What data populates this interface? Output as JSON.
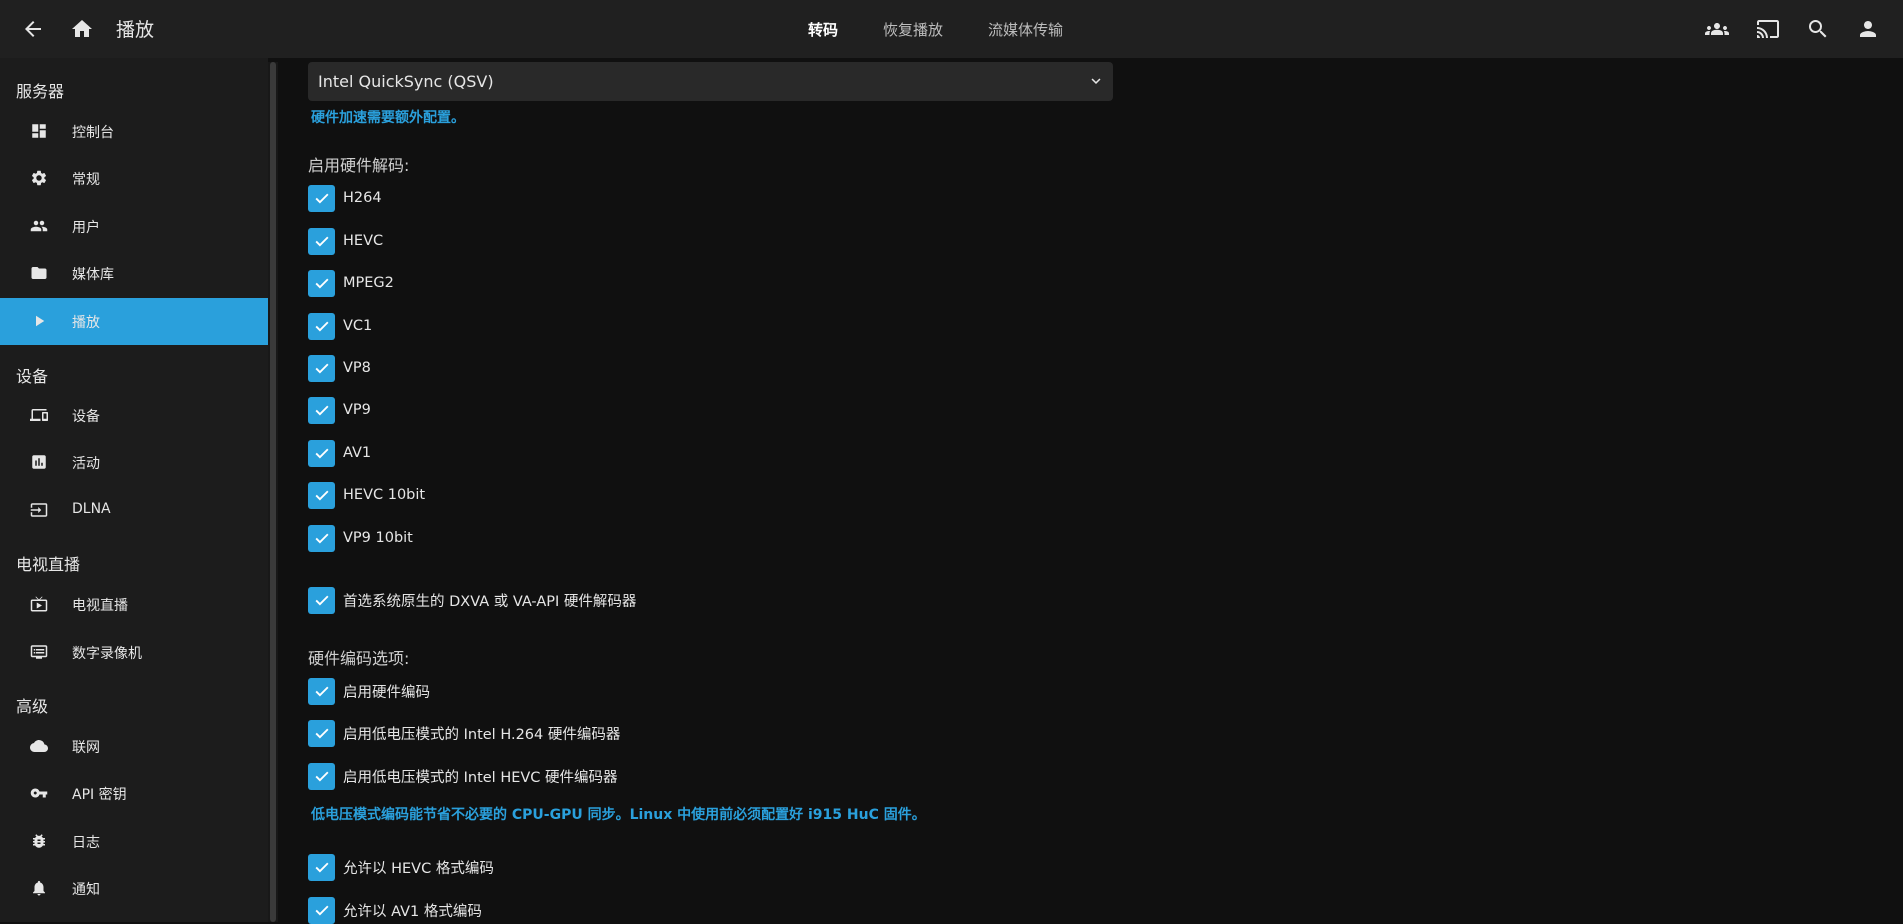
{
  "header": {
    "title": "播放",
    "tabs": [
      {
        "label": "转码",
        "active": true
      },
      {
        "label": "恢复播放",
        "active": false
      },
      {
        "label": "流媒体传输",
        "active": false
      }
    ],
    "icons": [
      "back-arrow-icon",
      "home-icon",
      "users-group-icon",
      "cast-icon",
      "search-icon",
      "user-icon"
    ]
  },
  "sidebar": {
    "sections": [
      {
        "heading": "服务器",
        "items": [
          {
            "label": "控制台",
            "icon": "dashboard-icon"
          },
          {
            "label": "常规",
            "icon": "gear-icon"
          },
          {
            "label": "用户",
            "icon": "people-icon"
          },
          {
            "label": "媒体库",
            "icon": "folder-icon"
          },
          {
            "label": "播放",
            "icon": "play-icon",
            "active": true
          }
        ]
      },
      {
        "heading": "设备",
        "items": [
          {
            "label": "设备",
            "icon": "devices-icon"
          },
          {
            "label": "活动",
            "icon": "activity-chart-icon"
          },
          {
            "label": "DLNA",
            "icon": "input-icon"
          }
        ]
      },
      {
        "heading": "电视直播",
        "items": [
          {
            "label": "电视直播",
            "icon": "live-tv-icon"
          },
          {
            "label": "数字录像机",
            "icon": "dvr-icon"
          }
        ]
      },
      {
        "heading": "高级",
        "items": [
          {
            "label": "联网",
            "icon": "cloud-icon"
          },
          {
            "label": "API 密钥",
            "icon": "key-icon"
          },
          {
            "label": "日志",
            "icon": "bug-icon"
          },
          {
            "label": "通知",
            "icon": "bell-icon"
          }
        ]
      }
    ]
  },
  "main": {
    "hw_accel": {
      "value": "Intel QuickSync (QSV)",
      "note": "硬件加速需要额外配置。"
    },
    "decode": {
      "label": "启用硬件解码:",
      "options": [
        {
          "label": "H264",
          "checked": true
        },
        {
          "label": "HEVC",
          "checked": true
        },
        {
          "label": "MPEG2",
          "checked": true
        },
        {
          "label": "VC1",
          "checked": true
        },
        {
          "label": "VP8",
          "checked": true
        },
        {
          "label": "VP9",
          "checked": true
        },
        {
          "label": "AV1",
          "checked": true
        },
        {
          "label": "HEVC 10bit",
          "checked": true
        },
        {
          "label": "VP9 10bit",
          "checked": true
        }
      ]
    },
    "prefer_native": {
      "label": "首选系统原生的 DXVA 或 VA-API 硬件解码器",
      "checked": true
    },
    "encode": {
      "label": "硬件编码选项:",
      "options": [
        {
          "label": "启用硬件编码",
          "checked": true
        },
        {
          "label": "启用低电压模式的 Intel H.264 硬件编码器",
          "checked": true
        },
        {
          "label": "启用低电压模式的 Intel HEVC 硬件编码器",
          "checked": true
        }
      ],
      "note": "低电压模式编码能节省不必要的 CPU-GPU 同步。Linux 中使用前必须配置好 i915 HuC 固件。"
    },
    "allow_formats": [
      {
        "label": "允许以 HEVC 格式编码",
        "checked": true
      },
      {
        "label": "允许以 AV1 格式编码",
        "checked": true
      }
    ]
  },
  "colors": {
    "accent": "#2aa0dc",
    "header_bg": "#202020",
    "sidebar_bg": "#1c1c1c",
    "page_bg": "#101010"
  }
}
